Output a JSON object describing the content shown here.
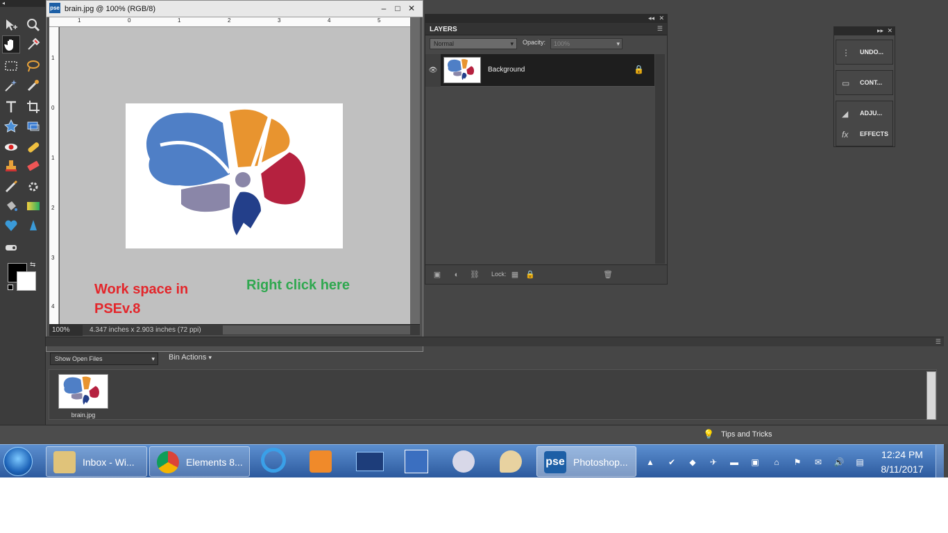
{
  "document": {
    "title": "brain.jpg @ 100% (RGB/8)",
    "badge": "pse",
    "zoom": "100%",
    "info": "4.347 inches x 2.903 inches (72 ppi)",
    "ruler_top_numbers": [
      "1",
      "0",
      "1",
      "2",
      "3",
      "4",
      "5"
    ],
    "ruler_left_numbers": [
      "1",
      "0",
      "1",
      "2",
      "3",
      "4"
    ]
  },
  "annotations": {
    "workspace": "Work space in PSEv.8",
    "right_click": "Right click here"
  },
  "layers": {
    "title": "LAYERS",
    "blend_mode": "Normal",
    "opacity_label": "Opacity:",
    "opacity_value": "100%",
    "layer_name": "Background",
    "lock_label": "Lock:"
  },
  "palette": {
    "items": [
      {
        "label": "UNDO...",
        "icon": "undo-history-icon"
      },
      {
        "label": "CONT...",
        "icon": "content-icon"
      },
      {
        "label": "ADJU...",
        "icon": "adjustments-icon"
      },
      {
        "label": "EFFECTS",
        "icon": "effects-fx-icon"
      }
    ]
  },
  "bin": {
    "show_select": "Show Open Files",
    "actions": "Bin Actions",
    "file_name": "brain.jpg"
  },
  "tips": {
    "label": "Tips and Tricks"
  },
  "taskbar": {
    "buttons": [
      {
        "label": "Inbox - Wi...",
        "icon": "mail-icon"
      },
      {
        "label": "Elements 8...",
        "icon": "chrome-icon"
      },
      {
        "label": "Photoshop...",
        "icon": "pse-icon"
      }
    ],
    "pse_icon_text": "pse",
    "time": "12:24 PM",
    "date": "8/11/2017"
  },
  "colors": {
    "workspace_text": "#e3262b",
    "right_click_text": "#2fa84f",
    "brain_blue": "#4f7fc6",
    "brain_orange": "#e8942f",
    "brain_red": "#b5213f",
    "brain_gray": "#8a86a8",
    "brain_navy": "#233f8a"
  }
}
